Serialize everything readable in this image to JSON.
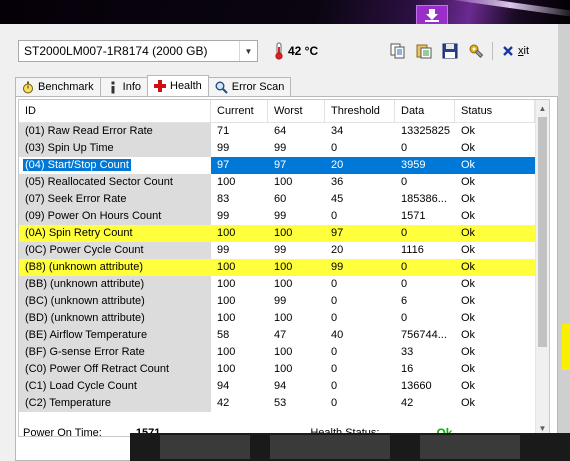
{
  "drive": {
    "name": "ST2000LM007-1R8174 (2000 GB)"
  },
  "temperature": "42 °C",
  "toolbar": {
    "exit_label": "Exit",
    "exit_key": "x"
  },
  "tabs": [
    {
      "label": "Benchmark",
      "icon": "stopwatch-icon"
    },
    {
      "label": "Info",
      "icon": "info-icon"
    },
    {
      "label": "Health",
      "icon": "plus-cross-icon"
    },
    {
      "label": "Error Scan",
      "icon": "magnifier-icon"
    }
  ],
  "table": {
    "columns": [
      "ID",
      "Current",
      "Worst",
      "Threshold",
      "Data",
      "Status"
    ],
    "rows": [
      {
        "cells": [
          "(01) Raw Read Error Rate",
          "71",
          "64",
          "34",
          "13325825",
          "Ok"
        ],
        "highlight": ""
      },
      {
        "cells": [
          "(03) Spin Up Time",
          "99",
          "99",
          "0",
          "0",
          "Ok"
        ],
        "highlight": ""
      },
      {
        "cells": [
          "(04) Start/Stop Count",
          "97",
          "97",
          "20",
          "3959",
          "Ok"
        ],
        "highlight": "selected"
      },
      {
        "cells": [
          "(05) Reallocated Sector Count",
          "100",
          "100",
          "36",
          "0",
          "Ok"
        ],
        "highlight": ""
      },
      {
        "cells": [
          "(07) Seek Error Rate",
          "83",
          "60",
          "45",
          "185386...",
          "Ok"
        ],
        "highlight": ""
      },
      {
        "cells": [
          "(09) Power On Hours Count",
          "99",
          "99",
          "0",
          "1571",
          "Ok"
        ],
        "highlight": ""
      },
      {
        "cells": [
          "(0A) Spin Retry Count",
          "100",
          "100",
          "97",
          "0",
          "Ok"
        ],
        "highlight": "yellow"
      },
      {
        "cells": [
          "(0C) Power Cycle Count",
          "99",
          "99",
          "20",
          "1116",
          "Ok"
        ],
        "highlight": ""
      },
      {
        "cells": [
          "(B8) (unknown attribute)",
          "100",
          "100",
          "99",
          "0",
          "Ok"
        ],
        "highlight": "yellow"
      },
      {
        "cells": [
          "(BB) (unknown attribute)",
          "100",
          "100",
          "0",
          "0",
          "Ok"
        ],
        "highlight": ""
      },
      {
        "cells": [
          "(BC) (unknown attribute)",
          "100",
          "99",
          "0",
          "6",
          "Ok"
        ],
        "highlight": ""
      },
      {
        "cells": [
          "(BD) (unknown attribute)",
          "100",
          "100",
          "0",
          "0",
          "Ok"
        ],
        "highlight": ""
      },
      {
        "cells": [
          "(BE) Airflow Temperature",
          "58",
          "47",
          "40",
          "756744...",
          "Ok"
        ],
        "highlight": ""
      },
      {
        "cells": [
          "(BF) G-sense Error Rate",
          "100",
          "100",
          "0",
          "33",
          "Ok"
        ],
        "highlight": ""
      },
      {
        "cells": [
          "(C0) Power Off Retract Count",
          "100",
          "100",
          "0",
          "16",
          "Ok"
        ],
        "highlight": ""
      },
      {
        "cells": [
          "(C1) Load Cycle Count",
          "94",
          "94",
          "0",
          "13660",
          "Ok"
        ],
        "highlight": ""
      },
      {
        "cells": [
          "(C2) Temperature",
          "42",
          "53",
          "0",
          "42",
          "Ok"
        ],
        "highlight": ""
      }
    ]
  },
  "status": {
    "power_on_label": "Power On Time:",
    "power_on_value": "1571",
    "health_label": "Health Status:",
    "health_value": "Ok"
  },
  "colors": {
    "selection": "#0078d7",
    "warning_row": "#ffff3c",
    "ok_text": "#00b400",
    "purple_button": "#9a2ec8"
  }
}
